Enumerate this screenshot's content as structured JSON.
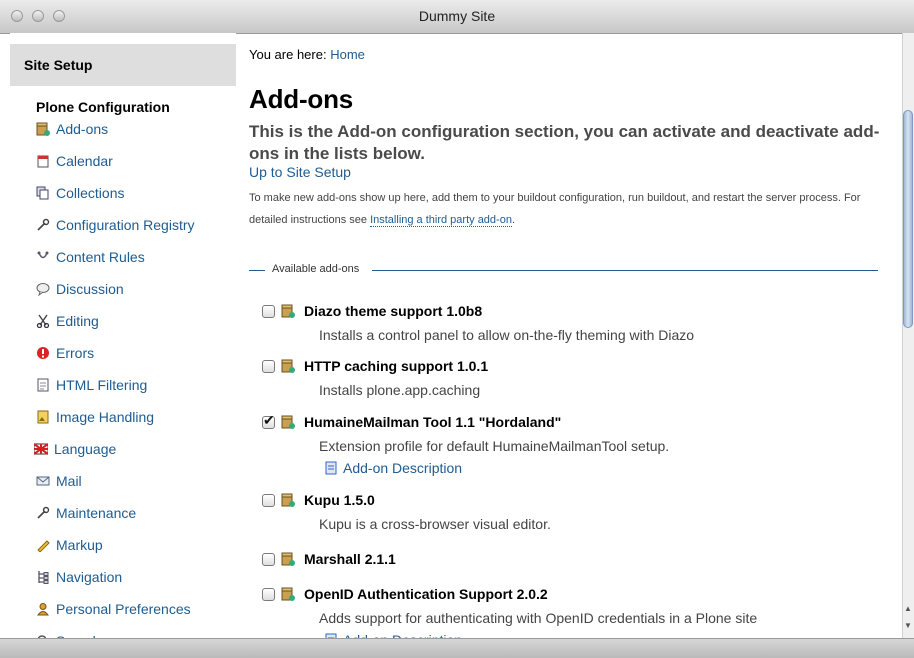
{
  "window": {
    "title": "Dummy Site"
  },
  "sidebar": {
    "header": "Site Setup",
    "section": "Plone Configuration",
    "items": [
      {
        "label": "Add-ons",
        "icon": "package-icon"
      },
      {
        "label": "Calendar",
        "icon": "calendar-icon"
      },
      {
        "label": "Collections",
        "icon": "collections-icon"
      },
      {
        "label": "Configuration Registry",
        "icon": "wrench-icon"
      },
      {
        "label": "Content Rules",
        "icon": "content-rules-icon"
      },
      {
        "label": "Discussion",
        "icon": "discussion-icon"
      },
      {
        "label": "Editing",
        "icon": "scissors-icon"
      },
      {
        "label": "Errors",
        "icon": "error-icon"
      },
      {
        "label": "HTML Filtering",
        "icon": "document-icon"
      },
      {
        "label": "Image Handling",
        "icon": "image-icon"
      },
      {
        "label": "Language",
        "icon": "language-flag-icon"
      },
      {
        "label": "Mail",
        "icon": "mail-icon"
      },
      {
        "label": "Maintenance",
        "icon": "wrench-icon"
      },
      {
        "label": "Markup",
        "icon": "pencil-icon"
      },
      {
        "label": "Navigation",
        "icon": "navigation-icon"
      },
      {
        "label": "Personal Preferences",
        "icon": "user-icon"
      },
      {
        "label": "Search",
        "icon": "search-icon"
      }
    ]
  },
  "main": {
    "breadcrumb_prefix": "You are here: ",
    "breadcrumb_home": "Home",
    "title": "Add-ons",
    "description": "This is the Add-on configuration section, you can activate and deactivate add-ons in the lists below.",
    "up_link": "Up to Site Setup",
    "hint_text": "To make new add-ons show up here, add them to your buildout configuration, run buildout, and restart the server process. For detailed instructions see ",
    "hint_link": "Installing a third party add-on",
    "hint_end": ".",
    "legend": "Available add-ons",
    "addons": [
      {
        "name": "Diazo theme support 1.0b8",
        "description": "Installs a control panel to allow on-the-fly theming with Diazo",
        "checked": false,
        "link": ""
      },
      {
        "name": "HTTP caching support 1.0.1",
        "description": "Installs plone.app.caching",
        "checked": false,
        "link": ""
      },
      {
        "name": "HumaineMailman Tool 1.1 \"Hordaland\"",
        "description": "Extension profile for default HumaineMailmanTool setup.",
        "checked": true,
        "link": "Add-on Description"
      },
      {
        "name": "Kupu 1.5.0",
        "description": "Kupu is a cross-browser visual editor.",
        "checked": false,
        "link": ""
      },
      {
        "name": "Marshall 2.1.1",
        "description": "",
        "checked": false,
        "link": ""
      },
      {
        "name": "OpenID Authentication Support 2.0.2",
        "description": "Adds support for authenticating with OpenID credentials in a Plone site",
        "checked": false,
        "link": "Add-on Description"
      }
    ]
  },
  "colors": {
    "link": "#205c90",
    "sidebar_header_bg": "#dedede"
  }
}
